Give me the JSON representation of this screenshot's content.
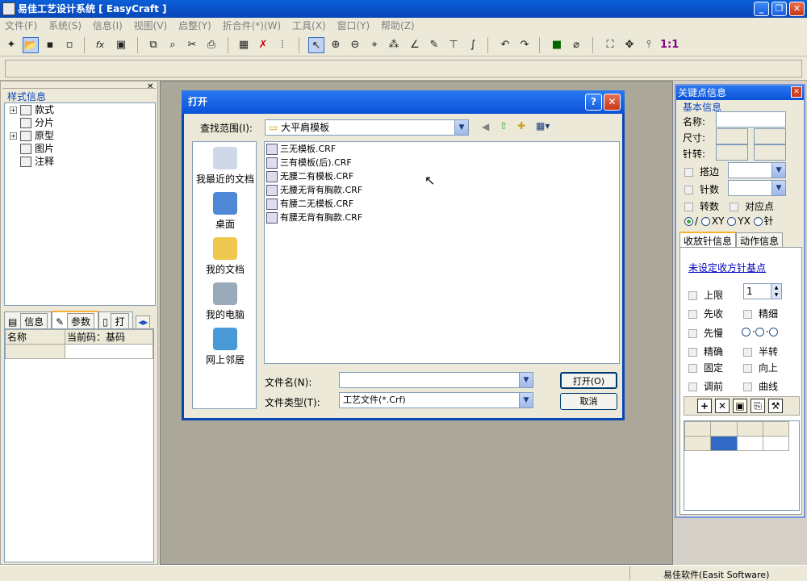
{
  "window": {
    "title": "易佳工艺设计系统 [ EasyCraft ]"
  },
  "menu": [
    "文件(F)",
    "系统(S)",
    "信息(I)",
    "视图(V)",
    "启整(Y)",
    "折合件(*)(W)",
    "工具(X)",
    "窗口(Y)",
    "帮助(Z)"
  ],
  "left_panel": {
    "title": "样式信息",
    "tree": [
      "款式",
      "分片",
      "原型",
      "图片",
      "注释"
    ],
    "tabs": [
      "信息",
      "参数",
      "打"
    ],
    "table_headers": [
      "名称",
      "当前码：基码"
    ]
  },
  "dialog": {
    "title": "打开",
    "look_in_label": "查找范围(I):",
    "look_in_value": "大平肩模板",
    "places": [
      "我最近的文档",
      "桌面",
      "我的文档",
      "我的电脑",
      "网上邻居"
    ],
    "files": [
      "三无模板.CRF",
      "三有模板(后).CRF",
      "无腰二有模板.CRF",
      "无腰无背有胸款.CRF",
      "有腰二无模板.CRF",
      "有腰无背有胸款.CRF"
    ],
    "filename_label": "文件名(N):",
    "filename_value": "",
    "filetype_label": "文件类型(T):",
    "filetype_value": "工艺文件(*.Crf)",
    "open_button": "打开(O)",
    "cancel_button": "取消"
  },
  "right_panel": {
    "title": "关键点信息",
    "basic_info": "基本信息",
    "name_label": "名称:",
    "size_label": "尺寸:",
    "needle_label": "针转:",
    "check_dabian": "搭边",
    "check_zhenshu": "针数",
    "check_zhuanshu": "转数",
    "check_duiyingdian": "对应点",
    "radios": [
      "/",
      "XY",
      "YX",
      "针"
    ],
    "tabs": [
      "收放针信息",
      "动作信息"
    ],
    "link": "未设定收方针基点",
    "upper_limit_label": "上限",
    "upper_limit_value": "1",
    "checks_left": [
      "先收",
      "先慢",
      "精确",
      "固定",
      "调前"
    ],
    "checks_right": [
      "精细",
      "",
      "半转",
      "向上",
      "曲线"
    ]
  },
  "status": {
    "text": "易佳软件(Easit Software)"
  }
}
